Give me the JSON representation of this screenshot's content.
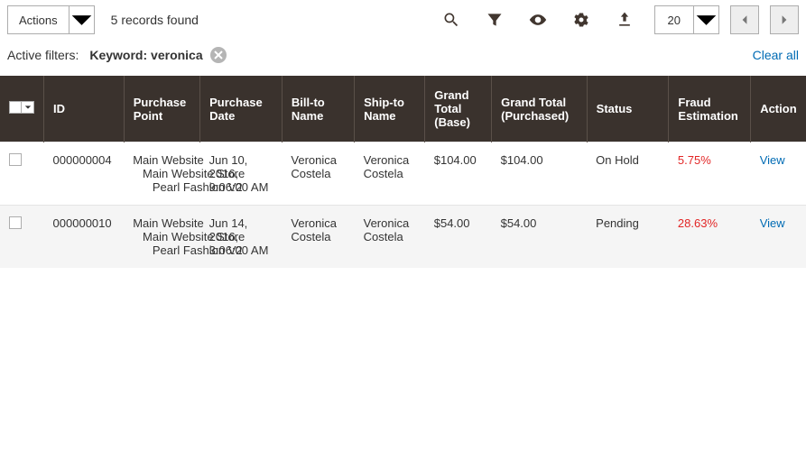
{
  "toolbar": {
    "actions_label": "Actions",
    "records_found": "5 records found",
    "page_size": "20"
  },
  "filters": {
    "label": "Active filters:",
    "keyword_label": "Keyword:",
    "keyword_value": "veronica",
    "clear_all": "Clear all"
  },
  "table": {
    "headers": {
      "id": "ID",
      "purchase_point": "Purchase Point",
      "purchase_date": "Purchase Date",
      "bill_to": "Bill-to Name",
      "ship_to": "Ship-to Name",
      "grand_total_base": "Grand Total (Base)",
      "grand_total_purchased": "Grand Total (Purchased)",
      "status": "Status",
      "fraud": "Fraud Estimation",
      "action": "Action"
    },
    "rows": [
      {
        "id": "000000004",
        "purchase_point": "Main Website\n   Main Website Store\n      Pearl Fashion V2",
        "purchase_date": "Jun 10, 2016, 9:06:00 AM",
        "bill_to": "Veronica Costela",
        "ship_to": "Veronica Costela",
        "grand_total_base": "$104.00",
        "grand_total_purchased": "$104.00",
        "status": "On Hold",
        "fraud": "5.75%",
        "fraud_class": "fraud-low",
        "action": "View"
      },
      {
        "id": "000000010",
        "purchase_point": "Main Website\n   Main Website Store\n      Pearl Fashion V2",
        "purchase_date": "Jun 14, 2016, 3:06:00 AM",
        "bill_to": "Veronica Costela",
        "ship_to": "Veronica Costela",
        "grand_total_base": "$54.00",
        "grand_total_purchased": "$54.00",
        "status": "Pending",
        "fraud": "28.63%",
        "fraud_class": "fraud-high",
        "action": "View"
      }
    ]
  }
}
